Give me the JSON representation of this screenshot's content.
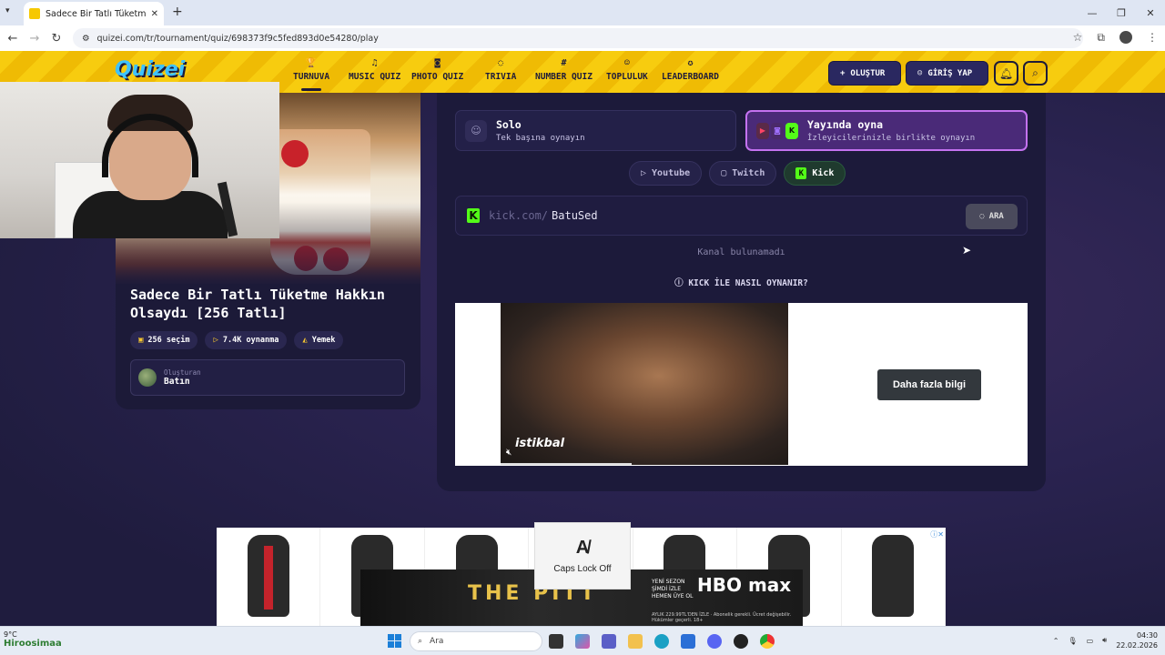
{
  "browser": {
    "tab_title": "Sadece Bir Tatlı Tüketme Hakkın",
    "url": "quizei.com/tr/tournament/quiz/698373f9c5fed893d0e54280/play"
  },
  "site": {
    "logo": "Quizei",
    "nav": [
      {
        "label": "TURNUVA",
        "icon": "trophy-icon"
      },
      {
        "label": "MUSIC QUIZ",
        "icon": "music-icon"
      },
      {
        "label": "PHOTO QUIZ",
        "icon": "camera-icon"
      },
      {
        "label": "TRIVIA",
        "icon": "chat-icon"
      },
      {
        "label": "NUMBER QUIZ",
        "icon": "hash-icon"
      },
      {
        "label": "TOPLULUK",
        "icon": "users-icon"
      },
      {
        "label": "LEADERBOARD",
        "icon": "medal-icon"
      }
    ],
    "create_label": "OLUŞTUR",
    "login_label": "GİRİŞ YAP"
  },
  "quiz": {
    "title": "Sadece Bir Tatlı Tüketme Hakkın Olsaydı [256 Tatlı]",
    "choices": "256 seçim",
    "plays": "7.4K oynanma",
    "category": "Yemek",
    "creator_label": "Oluşturan",
    "creator_name": "Batın"
  },
  "play": {
    "solo_title": "Solo",
    "solo_sub": "Tek başına oynayın",
    "live_title": "Yayında oyna",
    "live_sub": "İzleyicilerinizle birlikte oynayın",
    "platforms": [
      "Youtube",
      "Twitch",
      "Kick"
    ],
    "prefix": "kick.com/",
    "channel_value": "BatuSed",
    "search_label": "ARA",
    "not_found": "Kanal bulunamadı",
    "howto": "KICK İLE NASIL OYNANIR?"
  },
  "ads": {
    "video_brand": "istikbal",
    "cta": "Daha fazla bilgi",
    "hbo_show": "THE PITT",
    "hbo_brand": "HBO max",
    "hbo_promo": "YENİ SEZON ŞİMDİ İZLE",
    "hbo_join": "HEMEN ÜYE OL",
    "hbo_price": "AYLIK 229.99TL'DEN İZLE",
    "hbo_terms": "Abonelik gerekli. Ücret değişebilir. Hükümler geçerli. 18+"
  },
  "osd": {
    "caps": "Caps Lock Off"
  },
  "taskbar": {
    "temp": "9°C",
    "user": "Hiroosimaa",
    "search": "Ara",
    "time": "04:30",
    "date": "22.02.2026"
  },
  "colors": {
    "accent": "#f7cc0f",
    "panel": "#1c1a3a",
    "kick": "#53fc18",
    "live": "#c472f0"
  }
}
